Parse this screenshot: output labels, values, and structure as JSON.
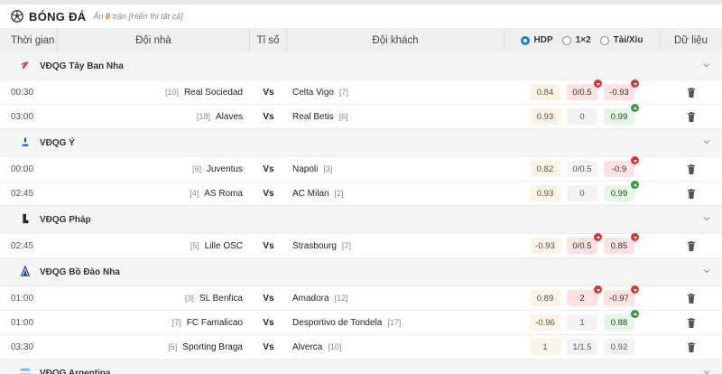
{
  "header": {
    "title": "BÓNG ĐÁ",
    "hidden_prefix": "Ẩn",
    "hidden_count": "0",
    "hidden_suffix": "trận",
    "show_all": "[Hiển thị tất cả]"
  },
  "columns": {
    "time": "Thời gian",
    "home": "Đội nhà",
    "score": "Tỉ số",
    "away": "Đội khách",
    "data": "Dữ liệu"
  },
  "odds_options": [
    {
      "label": "HDP",
      "selected": true
    },
    {
      "label": "1×2",
      "selected": false
    },
    {
      "label": "Tài/Xỉu",
      "selected": false
    }
  ],
  "vs_label": "Vs",
  "colors": {
    "accent": "#1c7ed6",
    "down": "#e03131",
    "up": "#2f9e44",
    "red_bg": "#fde2e2",
    "green_bg": "#e3f8e5"
  },
  "leagues": [
    {
      "name": "VĐQG Tây Ban Nha",
      "icon": "laliga-icon",
      "matches": [
        {
          "time": "00:30",
          "home_rank": "[10]",
          "home": "Real Sociedad",
          "away": "Celta Vigo",
          "away_rank": "[7]",
          "odds": [
            {
              "v": "0.84",
              "s": "hdp"
            },
            {
              "v": "0/0.5",
              "s": "red",
              "b": "down"
            },
            {
              "v": "-0.93",
              "s": "red",
              "b": "down"
            }
          ]
        },
        {
          "time": "03:00",
          "home_rank": "[18]",
          "home": "Alaves",
          "away": "Real Betis",
          "away_rank": "[6]",
          "odds": [
            {
              "v": "0.93",
              "s": "hdp"
            },
            {
              "v": "0",
              "s": "mid"
            },
            {
              "v": "0.99",
              "s": "green",
              "b": "up"
            }
          ]
        }
      ]
    },
    {
      "name": "VĐQG Ý",
      "icon": "serie-a-icon",
      "matches": [
        {
          "time": "00:00",
          "home_rank": "[6]",
          "home": "Juventus",
          "away": "Napoli",
          "away_rank": "[3]",
          "odds": [
            {
              "v": "0.82",
              "s": "hdp"
            },
            {
              "v": "0/0.5",
              "s": "mid"
            },
            {
              "v": "-0.9",
              "s": "red",
              "b": "down"
            }
          ]
        },
        {
          "time": "02:45",
          "home_rank": "[4]",
          "home": "AS Roma",
          "away": "AC Milan",
          "away_rank": "[2]",
          "odds": [
            {
              "v": "0.93",
              "s": "hdp"
            },
            {
              "v": "0",
              "s": "mid"
            },
            {
              "v": "0.99",
              "s": "green",
              "b": "up"
            }
          ]
        }
      ]
    },
    {
      "name": "VĐQG Pháp",
      "icon": "ligue1-icon",
      "matches": [
        {
          "time": "02:45",
          "home_rank": "[5]",
          "home": "Lille OSC",
          "away": "Strasbourg",
          "away_rank": "[7]",
          "odds": [
            {
              "v": "-0.93",
              "s": "hdp"
            },
            {
              "v": "0/0.5",
              "s": "red",
              "b": "down"
            },
            {
              "v": "0.85",
              "s": "red",
              "b": "down"
            }
          ]
        }
      ]
    },
    {
      "name": "VĐQG Bồ Đào Nha",
      "icon": "liga-portugal-icon",
      "matches": [
        {
          "time": "01:00",
          "home_rank": "[3]",
          "home": "SL Benfica",
          "away": "Amadora",
          "away_rank": "[12]",
          "odds": [
            {
              "v": "0.89",
              "s": "hdp"
            },
            {
              "v": "2",
              "s": "red",
              "b": "down"
            },
            {
              "v": "-0.97",
              "s": "red",
              "b": "down"
            }
          ]
        },
        {
          "time": "01:00",
          "home_rank": "[7]",
          "home": "FC Famalicao",
          "away": "Desportivo de Tondela",
          "away_rank": "[17]",
          "odds": [
            {
              "v": "-0.96",
              "s": "hdp"
            },
            {
              "v": "1",
              "s": "mid"
            },
            {
              "v": "0.88",
              "s": "green",
              "b": "up"
            }
          ]
        },
        {
          "time": "03:30",
          "home_rank": "[5]",
          "home": "Sporting Braga",
          "away": "Alverca",
          "away_rank": "[10]",
          "odds": [
            {
              "v": "1",
              "s": "hdp"
            },
            {
              "v": "1/1.5",
              "s": "mid"
            },
            {
              "v": "0.92",
              "s": "neutral"
            }
          ]
        }
      ]
    },
    {
      "name": "VĐQG Argentina",
      "icon": "argentina-league-icon",
      "matches": []
    }
  ]
}
